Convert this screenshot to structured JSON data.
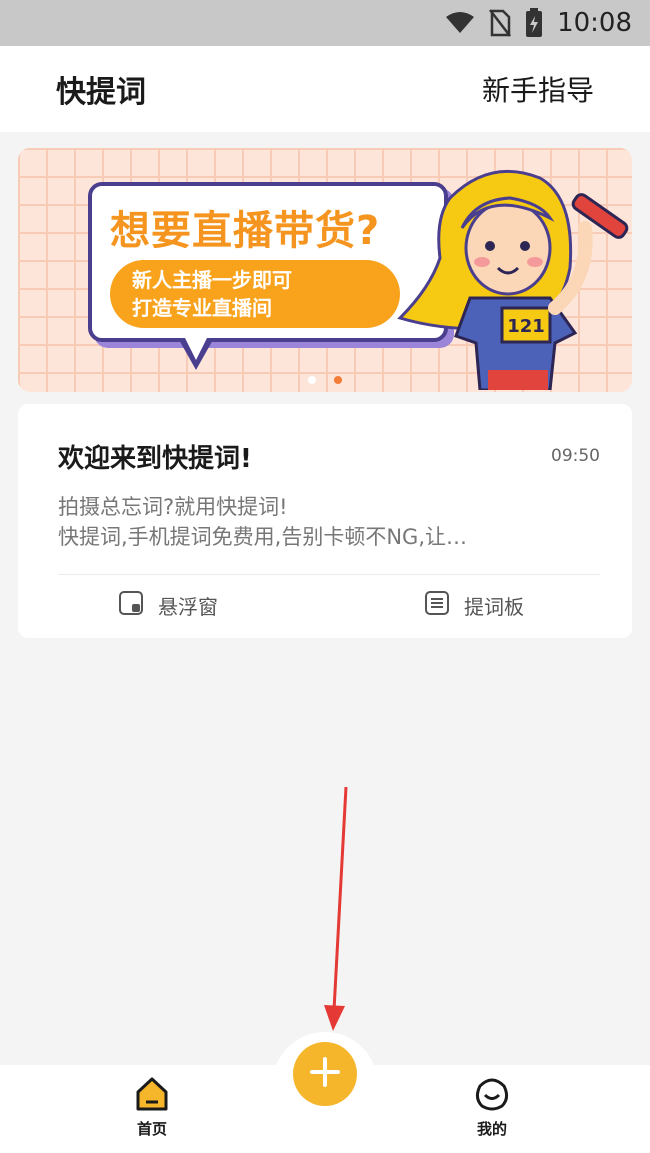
{
  "status_bar": {
    "time": "10:08",
    "icons": [
      "wifi-icon",
      "no-sim-icon",
      "battery-icon"
    ]
  },
  "header": {
    "title": "快提词",
    "guide_label": "新手指导"
  },
  "banner": {
    "headline": "想要直播带货?",
    "pill_line1": "新人主播一步即可",
    "pill_line2": "打造专业直播间",
    "badge_number": "121",
    "slide_count": 2,
    "active_slide": 2
  },
  "card": {
    "title": "欢迎来到快提词!",
    "time": "09:50",
    "line1": "拍摄总忘词?就用快提词!",
    "line2": "快提词,手机提词免费用,告别卡顿不NG,让…",
    "actions": [
      {
        "label": "悬浮窗",
        "icon": "floating-window-icon"
      },
      {
        "label": "提词板",
        "icon": "prompter-board-icon"
      }
    ]
  },
  "tab_bar": {
    "items": [
      {
        "label": "首页",
        "icon": "home-icon"
      },
      {
        "label": "我的",
        "icon": "profile-icon"
      }
    ],
    "add_button_icon": "plus-icon"
  },
  "colors": {
    "accent": "#f5b62b",
    "headline_orange": "#f5941e",
    "banner_bg": "#fde6d9",
    "annotation_red": "#e53935"
  }
}
